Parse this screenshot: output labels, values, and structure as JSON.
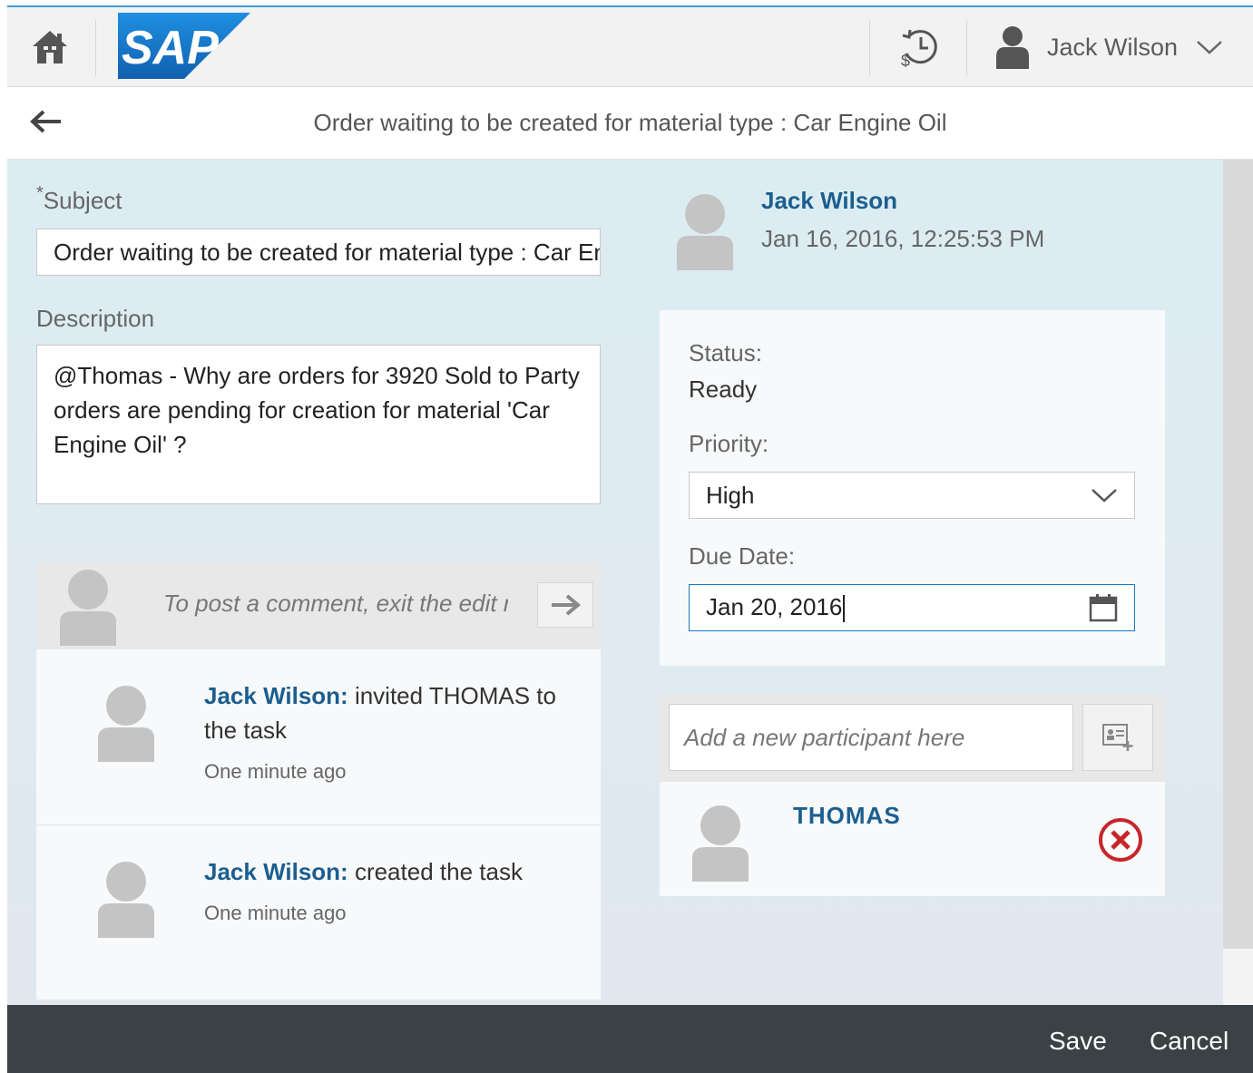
{
  "shell": {
    "logo_text": "SAP",
    "user_name": "Jack Wilson",
    "icons": [
      "home-icon",
      "sap-logo",
      "history-icon",
      "user-icon",
      "chevron-down-icon"
    ]
  },
  "header": {
    "title": "Order waiting to be created for material type : Car Engine Oil"
  },
  "form": {
    "subject_label": "Subject",
    "subject_required_mark": "*",
    "subject_value": "Order waiting to be created for material type : Car Engine Oil",
    "description_label": "Description",
    "description_value": "@Thomas - Why are orders for 3920 Sold to Party orders are pending for creation for material 'Car Engine Oil' ?"
  },
  "feed": {
    "placeholder": "To post a comment, exit the edit mode",
    "items": [
      {
        "author": "Jack Wilson:",
        "text": " invited THOMAS to the task",
        "time": "One minute ago"
      },
      {
        "author": "Jack Wilson:",
        "text": " created the task",
        "time": "One minute ago"
      }
    ]
  },
  "creator": {
    "name": "Jack Wilson",
    "date": "Jan 16, 2016, 12:25:53 PM"
  },
  "details": {
    "status_label": "Status:",
    "status_value": "Ready",
    "priority_label": "Priority:",
    "priority_value": "High",
    "due_label": "Due Date:",
    "due_value": "Jan 20, 2016"
  },
  "participants": {
    "placeholder": "Add a new participant here",
    "list": [
      {
        "name": "THOMAS"
      }
    ]
  },
  "footer": {
    "save_label": "Save",
    "cancel_label": "Cancel"
  },
  "colors": {
    "accent_blue": "#1c5e8f",
    "sap_blue": "#1a6fc0",
    "footer_bg": "#3c4145",
    "remove_red": "#c7262c",
    "content_bg": "#dcedf2"
  }
}
